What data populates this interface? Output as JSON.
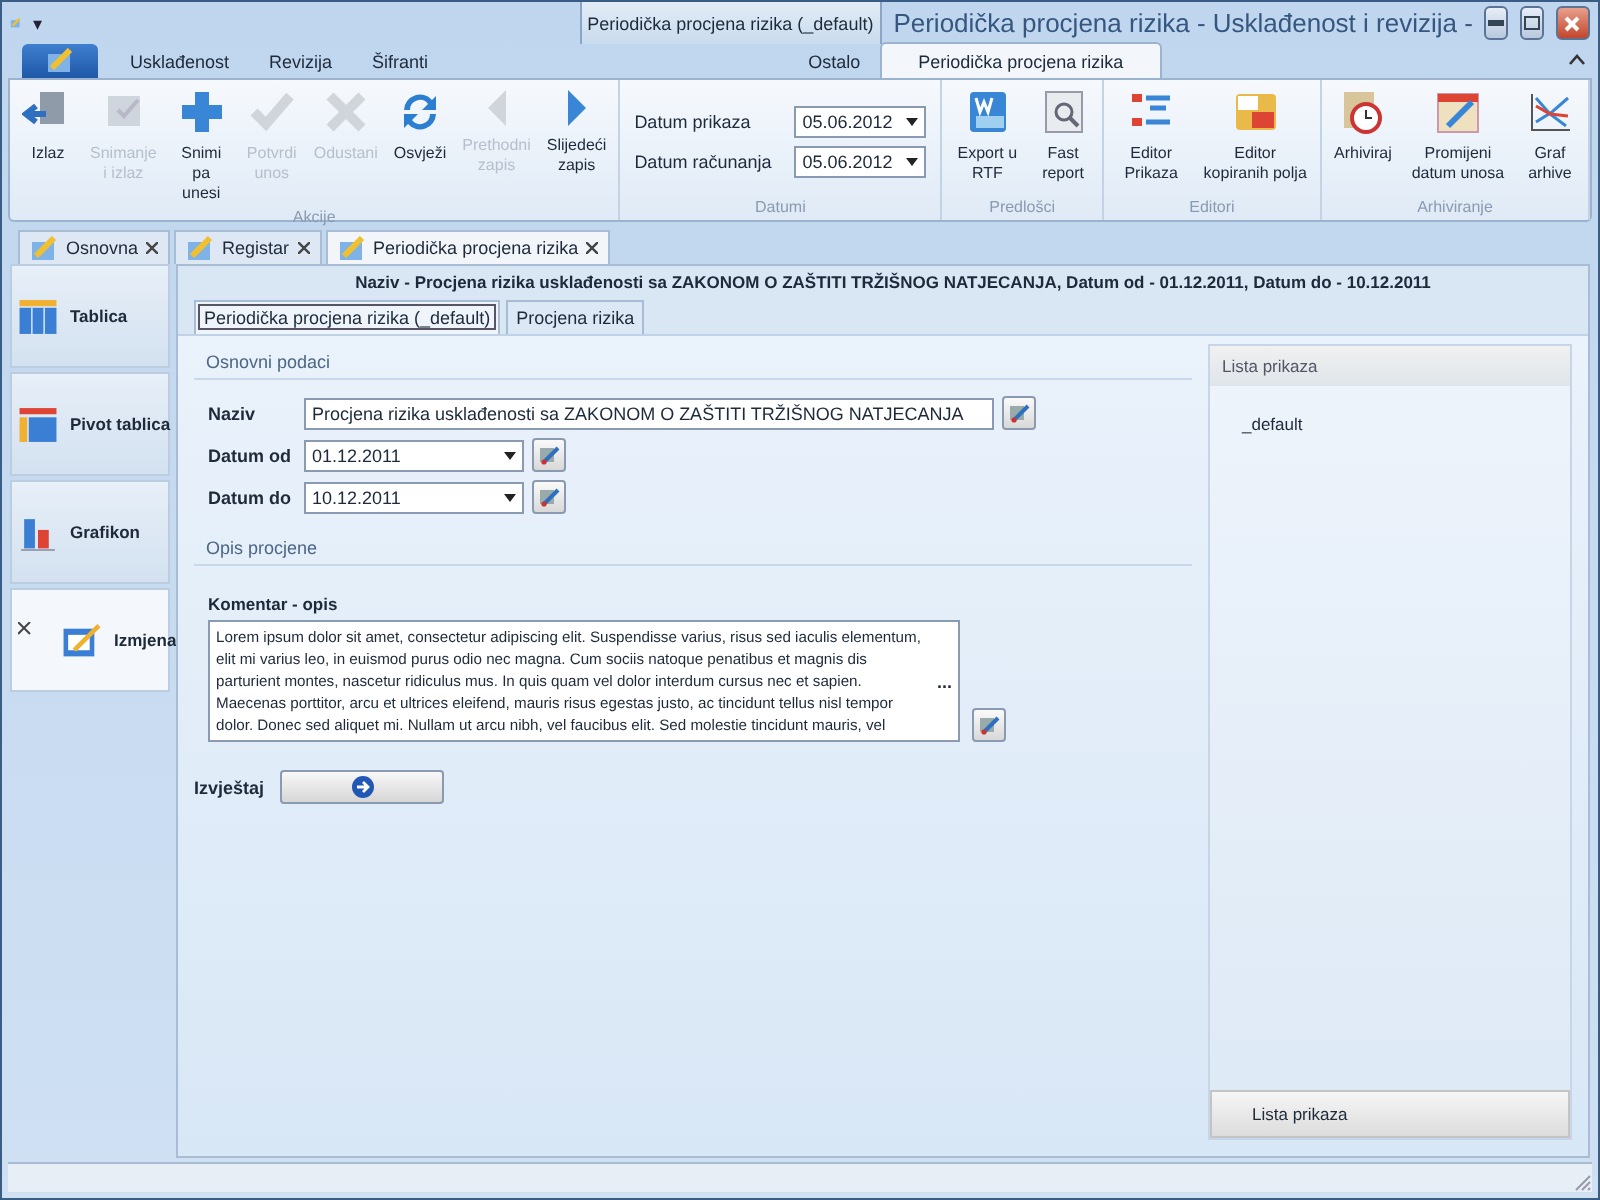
{
  "title_bar": {
    "contextual_group": "Periodička procjena rizika (_default)",
    "title": "Periodička procjena rizika - Usklađenost i revizija -",
    "quick_access": "▾"
  },
  "ribbon_tabs": [
    {
      "label": "Usklađenost",
      "selected": false
    },
    {
      "label": "Revizija",
      "selected": false
    },
    {
      "label": "Šifranti",
      "selected": false
    },
    {
      "label": "Ostalo",
      "selected": false
    },
    {
      "label": "Periodička procjena rizika",
      "selected": true
    }
  ],
  "ribbon_groups": [
    {
      "title": "Akcije",
      "kind": "buttons",
      "buttons": [
        {
          "label": "Izlaz",
          "disabled": false
        },
        {
          "label": "Snimanje i izlaz",
          "disabled": true
        },
        {
          "label": "Snimi pa unesi",
          "disabled": false
        },
        {
          "label": "Potvrdi unos",
          "disabled": true
        },
        {
          "label": "Odustani",
          "disabled": true
        },
        {
          "label": "Osvježi",
          "disabled": false
        },
        {
          "label": "Prethodni zapis",
          "disabled": true
        },
        {
          "label": "Slijedeći zapis",
          "disabled": false
        }
      ]
    },
    {
      "title": "Datumi",
      "kind": "dates",
      "fields": [
        {
          "label": "Datum prikaza",
          "value": "05.06.2012"
        },
        {
          "label": "Datum računanja",
          "value": "05.06.2012"
        }
      ]
    },
    {
      "title": "Predlošci",
      "kind": "buttons",
      "buttons": [
        {
          "label": "Export u RTF",
          "disabled": false
        },
        {
          "label": "Fast report",
          "disabled": false
        }
      ]
    },
    {
      "title": "Editori",
      "kind": "buttons",
      "buttons": [
        {
          "label": "Editor Prikaza",
          "disabled": false
        },
        {
          "label": "Editor kopiranih polja",
          "disabled": false
        }
      ]
    },
    {
      "title": "Arhiviranje",
      "kind": "buttons",
      "buttons": [
        {
          "label": "Arhiviraj",
          "disabled": false
        },
        {
          "label": "Promijeni datum unosa",
          "disabled": false
        },
        {
          "label": "Graf arhive",
          "disabled": false
        }
      ]
    }
  ],
  "doc_tabs": [
    {
      "label": "Osnovna",
      "selected": false
    },
    {
      "label": "Registar",
      "selected": false
    },
    {
      "label": "Periodička procjena rizika",
      "selected": true
    }
  ],
  "nav": [
    {
      "label": "Tablica",
      "selected": false
    },
    {
      "label": "Pivot tablica",
      "selected": false
    },
    {
      "label": "Grafikon",
      "selected": false
    },
    {
      "label": "Izmjena",
      "selected": true
    }
  ],
  "header": "Naziv - Procjena rizika usklađenosti sa ZAKONOM O ZAŠTITI TRŽIŠNOG NATJECANJA, Datum od - 01.12.2011, Datum do - 10.12.2011",
  "form_tabs": [
    {
      "label": "Periodička procjena rizika (_default)",
      "selected": true
    },
    {
      "label": "Procjena rizika",
      "selected": false
    }
  ],
  "basic": {
    "title": "Osnovni podaci",
    "fields": [
      {
        "label": "Naziv",
        "value": "Procjena rizika usklađenosti sa ZAKONOM O ZAŠTITI TRŽIŠNOG NATJECANJA",
        "kind": "text"
      },
      {
        "label": "Datum od",
        "value": "01.12.2011",
        "kind": "date"
      },
      {
        "label": "Datum do",
        "value": "10.12.2011",
        "kind": "date"
      }
    ]
  },
  "description": {
    "title": "Opis procjene",
    "label": "Komentar - opis",
    "text": "Lorem ipsum dolor sit amet, consectetur adipiscing elit. Suspendisse varius, risus sed iaculis elementum, elit mi varius leo, in euismod purus odio nec magna. Cum sociis natoque penatibus et magnis dis parturient montes, nascetur ridiculus mus. In quis quam vel dolor interdum cursus nec et sapien. Maecenas porttitor, arcu et ultrices eleifend, mauris risus egestas justo, ac tincidunt tellus nisl tempor dolor. Donec sed aliquet mi. Nullam ut arcu nibh, vel faucibus elit. Sed molestie tincidunt mauris, vel",
    "more": "..."
  },
  "report": {
    "label": "Izvještaj"
  },
  "list_panel": {
    "title": "Lista prikaza",
    "items": [
      "_default"
    ],
    "footer_button": "Lista prikaza"
  }
}
